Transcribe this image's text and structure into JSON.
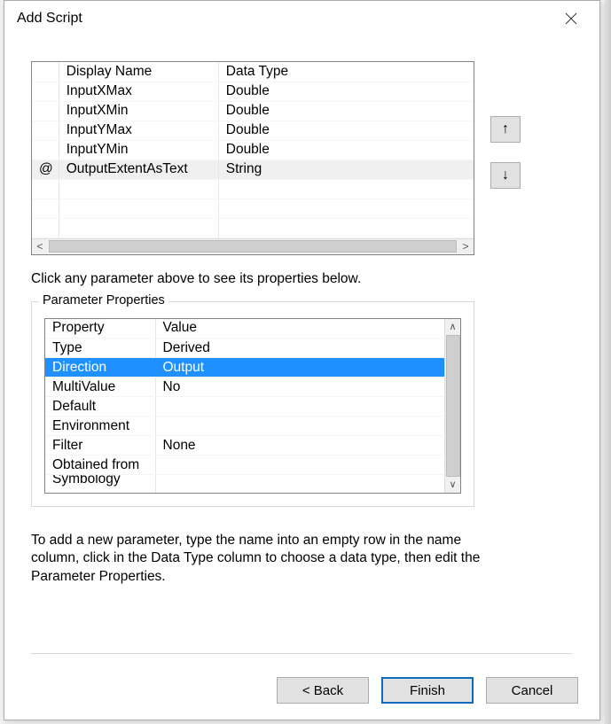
{
  "title": "Add Script",
  "params_table": {
    "headers": {
      "marker": "",
      "name": "Display Name",
      "type": "Data Type"
    },
    "rows": [
      {
        "marker": "",
        "name": "InputXMax",
        "type": "Double",
        "selected": false
      },
      {
        "marker": "",
        "name": "InputXMin",
        "type": "Double",
        "selected": false
      },
      {
        "marker": "",
        "name": "InputYMax",
        "type": "Double",
        "selected": false
      },
      {
        "marker": "",
        "name": "InputYMin",
        "type": "Double",
        "selected": false
      },
      {
        "marker": "@",
        "name": "OutputExtentAsText",
        "type": "String",
        "selected": true
      },
      {
        "marker": "",
        "name": "",
        "type": "",
        "selected": false
      },
      {
        "marker": "",
        "name": "",
        "type": "",
        "selected": false
      },
      {
        "marker": "",
        "name": "",
        "type": "",
        "selected": false
      }
    ]
  },
  "instruction": "Click any parameter above to see its properties below.",
  "properties_legend": "Parameter Properties",
  "properties_table": {
    "headers": {
      "prop": "Property",
      "val": "Value"
    },
    "rows": [
      {
        "prop": "Type",
        "val": "Derived",
        "selected": false
      },
      {
        "prop": "Direction",
        "val": "Output",
        "selected": true
      },
      {
        "prop": "MultiValue",
        "val": "No",
        "selected": false
      },
      {
        "prop": "Default",
        "val": "",
        "selected": false
      },
      {
        "prop": "Environment",
        "val": "",
        "selected": false
      },
      {
        "prop": "Filter",
        "val": "None",
        "selected": false
      },
      {
        "prop": "Obtained from",
        "val": "",
        "selected": false
      },
      {
        "prop": "Symbology",
        "val": "",
        "selected": false,
        "clipped": true
      }
    ]
  },
  "help_text": "To add a new parameter, type the name into an empty row in the name column, click in the Data Type column to choose a data type, then edit the Parameter Properties.",
  "buttons": {
    "back": "< Back",
    "finish": "Finish",
    "cancel": "Cancel"
  },
  "move_buttons": {
    "up": "↑",
    "down": "↓"
  },
  "scroll_arrows": {
    "left": "<",
    "right": ">",
    "up_small": "∧",
    "down_small": "∨"
  }
}
